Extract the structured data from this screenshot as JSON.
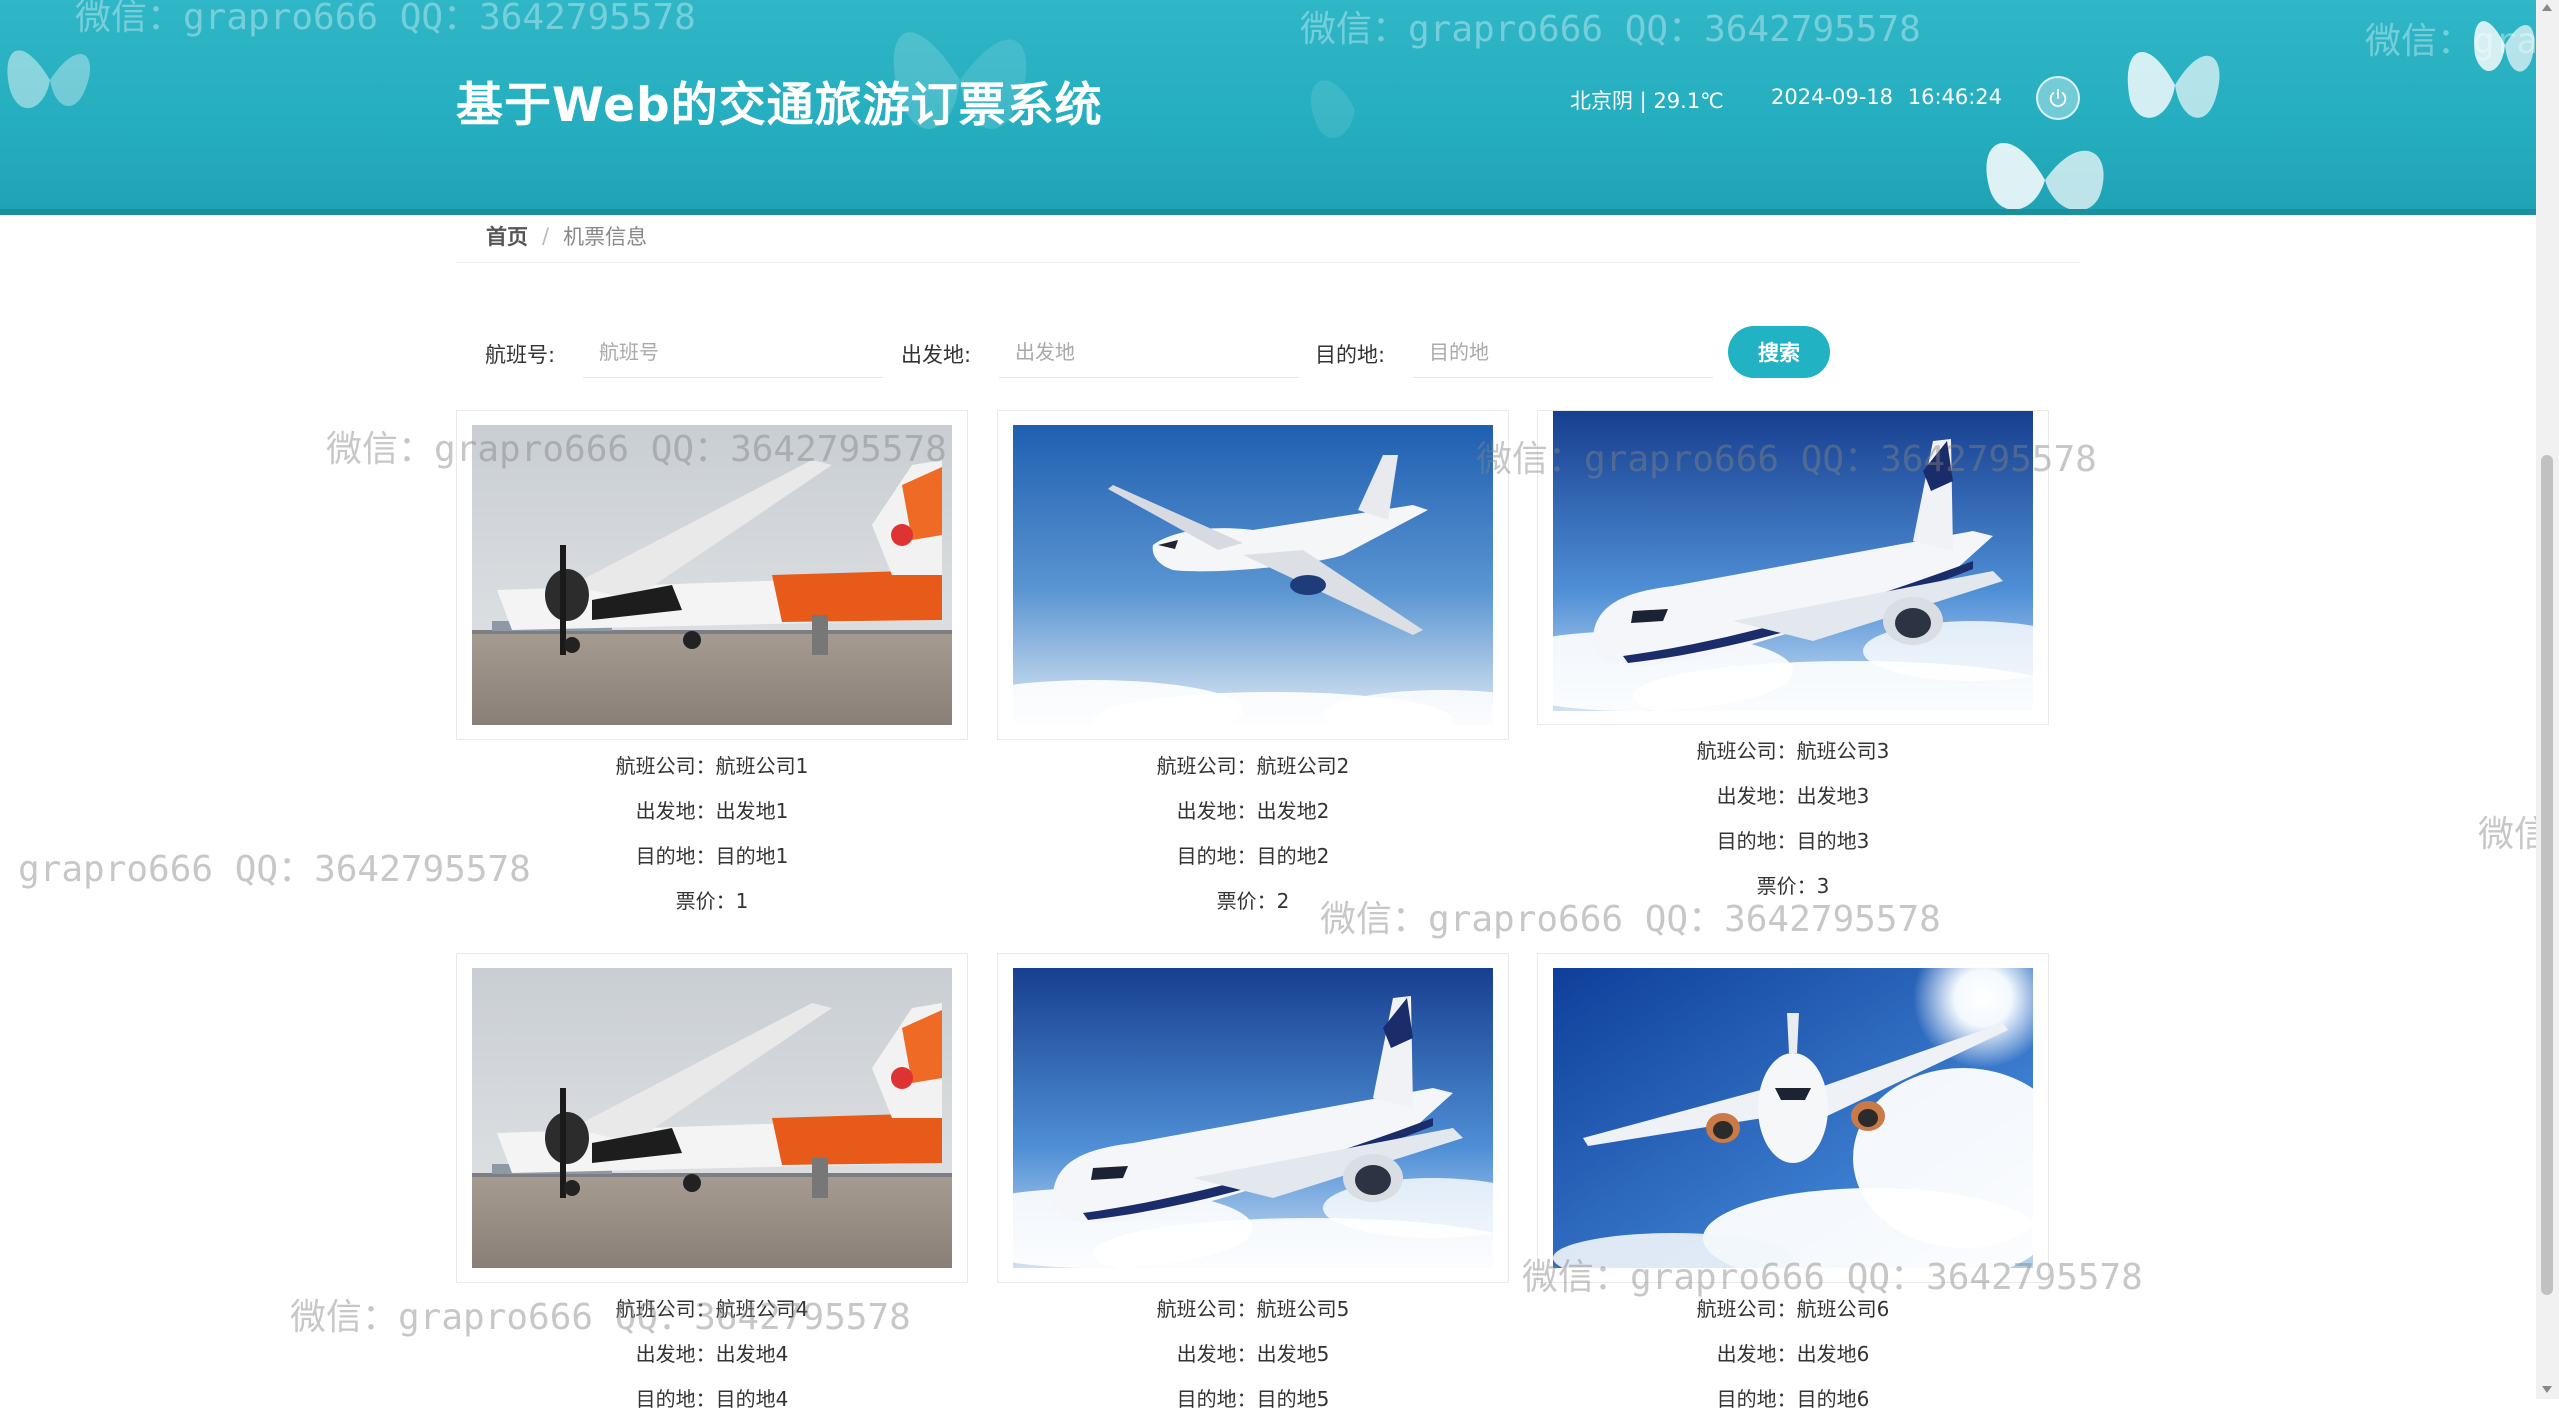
{
  "header": {
    "title": "基于Web的交通旅游订票系统",
    "weather": "北京阴 | 29.1℃",
    "datetime": "2024-09-18  16:46:24",
    "power_icon": "power-icon",
    "bg_color": "#25aebf"
  },
  "breadcrumb": {
    "home": "首页",
    "separator": "/",
    "current": "机票信息"
  },
  "search": {
    "flight_no_label": "航班号:",
    "flight_no_placeholder": "航班号",
    "origin_label": "出发地:",
    "origin_placeholder": "出发地",
    "destination_label": "目的地:",
    "destination_placeholder": "目的地",
    "button_label": "搜索",
    "button_color": "#21b3c4"
  },
  "cards": [
    {
      "image": "propeller-plane-photo",
      "airline": "航班公司：航班公司1",
      "origin": "出发地：出发地1",
      "destination": "目的地：目的地1",
      "price": "票价：1"
    },
    {
      "image": "jet-plane-photo",
      "airline": "航班公司：航班公司2",
      "origin": "出发地：出发地2",
      "destination": "目的地：目的地2",
      "price": "票价：2"
    },
    {
      "image": "jet-plane-closeup-photo",
      "airline": "航班公司：航班公司3",
      "origin": "出发地：出发地3",
      "destination": "目的地：目的地3",
      "price": "票价：3"
    },
    {
      "image": "propeller-plane-photo",
      "airline": "航班公司：航班公司4",
      "origin": "出发地：出发地4",
      "destination": "目的地：目的地4",
      "price": ""
    },
    {
      "image": "jet-plane-closeup-photo",
      "airline": "航班公司：航班公司5",
      "origin": "出发地：出发地5",
      "destination": "目的地：目的地5",
      "price": ""
    },
    {
      "image": "jet-plane-front-photo",
      "airline": "航班公司：航班公司6",
      "origin": "出发地：出发地6",
      "destination": "目的地：目的地6",
      "price": ""
    }
  ],
  "watermark": "微信：grapro666 QQ：3642795578"
}
